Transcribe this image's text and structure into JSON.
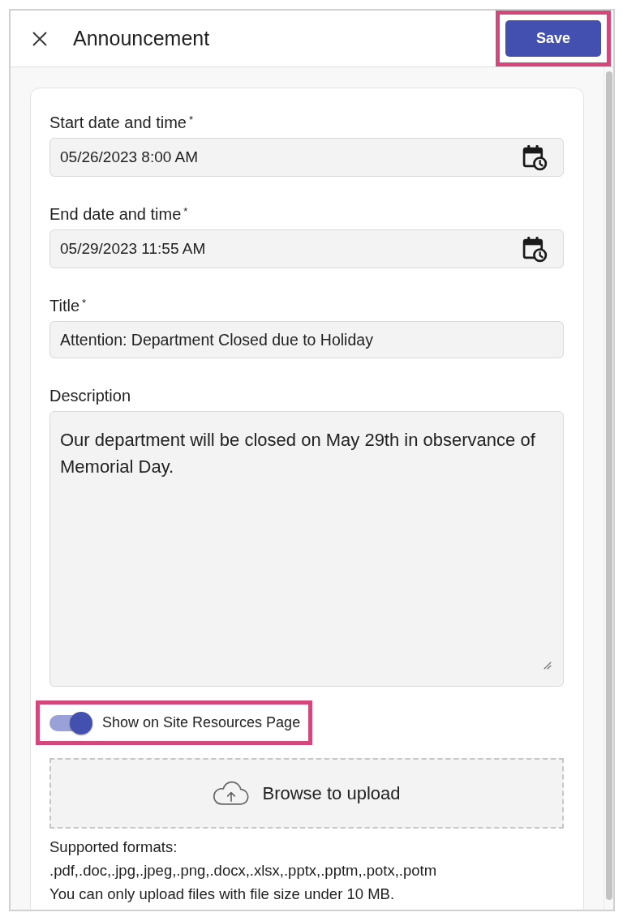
{
  "header": {
    "title": "Announcement",
    "save_button": {
      "label": "Save",
      "highlighted": true
    }
  },
  "form": {
    "fields": [
      {
        "kind": "datetime",
        "label": "Start date and time$^{*}$",
        "value": "05/26/2023 8:00 AM"
      },
      {
        "kind": "datetime",
        "label": "End date and time$^{*}$",
        "value": "05/29/2023 11:55 AM"
      },
      {
        "kind": "text",
        "label": "Title$^{*}$",
        "value": "Attention: Department Closed due to Holiday"
      },
      {
        "kind": "textarea",
        "label": "Description",
        "value": "Our department will be closed on May 29th in observance of Memorial Day."
      }
    ],
    "toggle": {
      "label": "Show on Site Resources Page",
      "on": true,
      "highlighted": true
    },
    "upload": {
      "label": "Browse to upload"
    },
    "help_lines": [
      "Supported formats:",
      ".pdf,.doc,.jpg,.jpeg,.png,.docx,.xlsx,.pptx,.pptm,.potx,.potm",
      "You can only upload files with file size under 10 MB."
    ]
  }
}
